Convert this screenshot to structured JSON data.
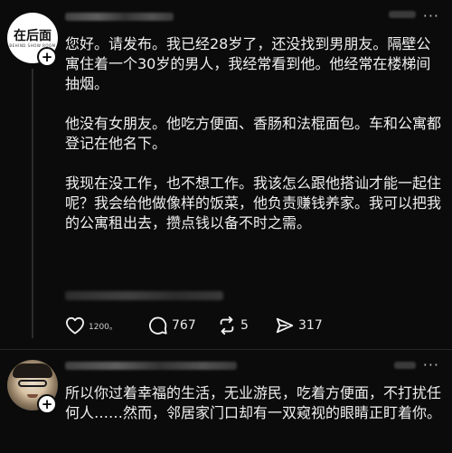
{
  "post1": {
    "avatar": {
      "logo_text": "在后面",
      "logo_subtext": "BEHIND SHOW ROOM"
    },
    "paragraphs": [
      "您好。请发布。我已经28岁了，还没找到男朋友。隔壁公寓住着一个30岁的男人，我经常看到他。他经常在楼梯间抽烟。",
      "他没有女朋友。他吃方便面、香肠和法棍面包。车和公寓都登记在他名下。",
      "我现在没工作，也不想工作。我该怎么跟他搭讪才能一起住呢？我会给他做像样的饭菜，他负责赚钱养家。我可以把我的公寓租出去，攒点钱以备不时之需。"
    ],
    "actions": {
      "likes": "1200。",
      "comments": "767",
      "reposts": "5",
      "shares": "317"
    },
    "more_icon": "ellipsis-icon"
  },
  "post2": {
    "text": "所以你过着幸福的生活，无业游民，吃着方便面，不打扰任何人……然而，邻居家门口却有一双窥视的眼睛正盯着你。",
    "more_icon": "ellipsis-icon"
  },
  "icons": {
    "like": "heart-icon",
    "comment": "speech-bubble-icon",
    "repost": "repost-arrows-icon",
    "share": "send-icon",
    "follow": "plus-icon"
  },
  "colors": {
    "background": "#0b0b0b",
    "text": "#f0f0f0",
    "divider": "#262626"
  }
}
